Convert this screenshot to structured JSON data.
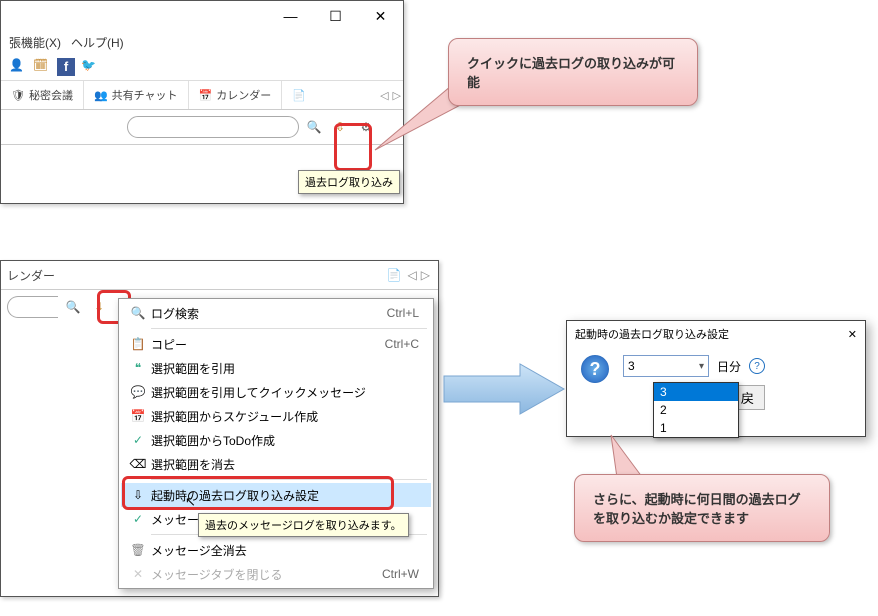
{
  "window1": {
    "menu_extensions": "張機能(X)",
    "menu_help": "ヘルプ(H)",
    "tb_secret": "秘密会議",
    "tb_shared_chat": "共有チャット",
    "tb_calendar": "カレンダー",
    "tooltip": "過去ログ取り込み"
  },
  "callout1": {
    "text": "クイックに過去ログの取り込みが可能"
  },
  "window2": {
    "tb_calendar": "レンダー"
  },
  "context_menu": {
    "items": [
      {
        "icon": "search",
        "label": "ログ検索",
        "shortcut": "Ctrl+L"
      },
      {
        "sep": true
      },
      {
        "icon": "copy",
        "label": "コピー",
        "shortcut": "Ctrl+C"
      },
      {
        "icon": "quote",
        "label": "選択範囲を引用"
      },
      {
        "icon": "quickmsg",
        "label": "選択範囲を引用してクイックメッセージ"
      },
      {
        "icon": "schedule",
        "label": "選択範囲からスケジュール作成"
      },
      {
        "icon": "todo",
        "label": "選択範囲からToDo作成"
      },
      {
        "icon": "erase",
        "label": "選択範囲を消去"
      },
      {
        "sep": true
      },
      {
        "icon": "settings",
        "label": "起動時の過去ログ取り込み設定",
        "highlighted": true
      },
      {
        "icon": "thread",
        "label": "メッセージスレッド表示"
      },
      {
        "sep": true
      },
      {
        "icon": "trash",
        "label": "メッセージ全消去"
      },
      {
        "icon": "close",
        "label": "メッセージタブを閉じる",
        "shortcut": "Ctrl+W",
        "disabled": true
      }
    ],
    "tooltip": "過去のメッセージログを取り込みます。"
  },
  "dialog": {
    "title": "起動時の過去ログ取り込み設定",
    "selected": "3",
    "suffix": "日分",
    "options": [
      "3",
      "2",
      "1"
    ],
    "button_hint": "戻"
  },
  "callout2": {
    "text": "さらに、起動時に何日間の過去ログを取り込むか設定できます"
  }
}
